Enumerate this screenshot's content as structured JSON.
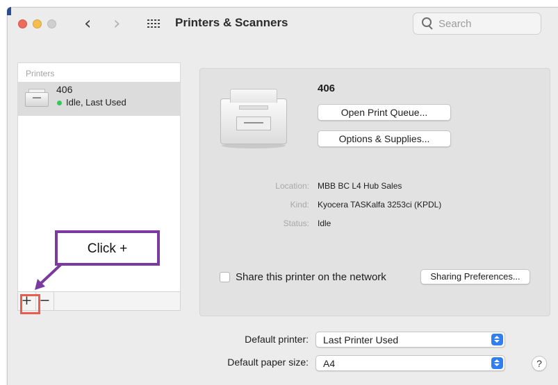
{
  "window": {
    "title": "Printers & Scanners",
    "back_glyph": "‹",
    "forward_glyph": "›"
  },
  "search": {
    "placeholder": "Search",
    "value": ""
  },
  "printers_list": {
    "header": "Printers",
    "items": [
      {
        "name": "406",
        "status": "Idle, Last Used",
        "status_color": "#34c759"
      }
    ],
    "add_label": "+",
    "remove_label": "−"
  },
  "detail": {
    "name": "406",
    "open_queue_label": "Open Print Queue...",
    "options_label": "Options & Supplies...",
    "location_label": "Location:",
    "location_value": "MBB BC L4 Hub Sales",
    "kind_label": "Kind:",
    "kind_value": "Kyocera TASKalfa 3253ci (KPDL)",
    "status_label": "Status:",
    "status_value": "Idle",
    "share_label": "Share this printer on the network",
    "share_checked": false,
    "sharing_prefs_label": "Sharing Preferences..."
  },
  "defaults": {
    "printer_label": "Default printer:",
    "printer_value": "Last Printer Used",
    "paper_label": "Default paper size:",
    "paper_value": "A4"
  },
  "help_label": "?",
  "annotation": {
    "callout_text": "Click +",
    "callout_color": "#7a3aa0",
    "highlight_color": "#ea5c50"
  },
  "colors": {
    "window_bg": "#ececec",
    "accent": "#2f7ff2",
    "selection": "#dcdcdc"
  }
}
